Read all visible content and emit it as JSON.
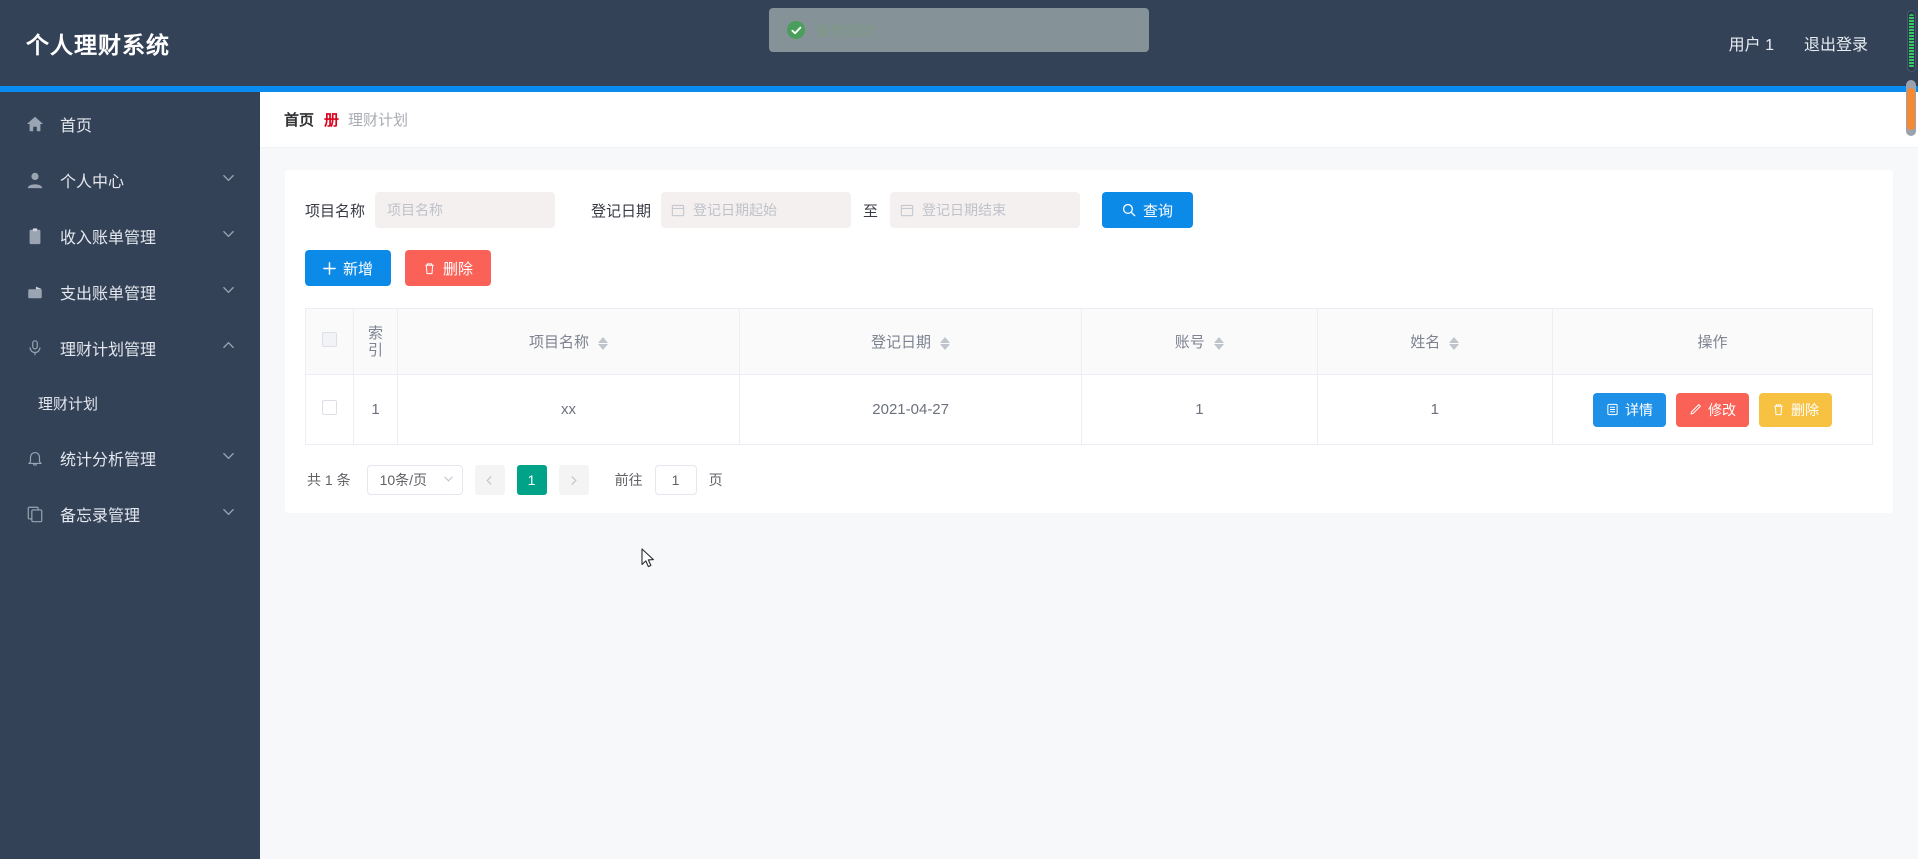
{
  "app": {
    "brand": "个人理财系统",
    "accent_blue": "#0c8ae8",
    "sidebar_bg": "#344258",
    "danger_red": "#fa6257",
    "warn_amber": "#f7c242",
    "page_active_teal": "#00a387"
  },
  "topbar": {
    "user_label": "用户 1",
    "logout_label": "退出登录"
  },
  "toast": {
    "message": "操作成功",
    "icon": "success-check-icon"
  },
  "sidebar": {
    "items": [
      {
        "label": "首页",
        "icon": "home-icon",
        "expandable": false
      },
      {
        "label": "个人中心",
        "icon": "user-icon",
        "expandable": true,
        "chevron": "down"
      },
      {
        "label": "收入账单管理",
        "icon": "clipboard-icon",
        "expandable": true,
        "chevron": "down"
      },
      {
        "label": "支出账单管理",
        "icon": "briefcase-icon",
        "expandable": true,
        "chevron": "down"
      },
      {
        "label": "理财计划管理",
        "icon": "microphone-icon",
        "expandable": true,
        "chevron": "up"
      },
      {
        "label": "统计分析管理",
        "icon": "bell-icon",
        "expandable": true,
        "chevron": "down"
      },
      {
        "label": "备忘录管理",
        "icon": "copy-icon",
        "expandable": true,
        "chevron": "down"
      }
    ],
    "submenu": {
      "label": "理财计划",
      "parent_index": 4
    }
  },
  "breadcrumb": {
    "home": "首页",
    "separator": "册",
    "current": "理财计划"
  },
  "filters": {
    "name_label": "项目名称",
    "name_value": "",
    "name_placeholder": "项目名称",
    "date_label": "登记日期",
    "date_start_placeholder": "登记日期起始",
    "date_start_value": "",
    "range_separator": "至",
    "date_end_placeholder": "登记日期结束",
    "date_end_value": "",
    "search_label": "查询",
    "search_icon": "search-icon"
  },
  "actions": {
    "add_label": "新增",
    "add_icon": "plus-icon",
    "delete_label": "删除",
    "delete_icon": "trash-icon"
  },
  "table": {
    "columns": [
      {
        "key": "select",
        "label": "",
        "sortable": false
      },
      {
        "key": "index",
        "label": "索引",
        "sortable": false
      },
      {
        "key": "project_name",
        "label": "项目名称",
        "sortable": true
      },
      {
        "key": "register_date",
        "label": "登记日期",
        "sortable": true
      },
      {
        "key": "account",
        "label": "账号",
        "sortable": true
      },
      {
        "key": "name",
        "label": "姓名",
        "sortable": true
      },
      {
        "key": "operations",
        "label": "操作",
        "sortable": false
      }
    ],
    "rows": [
      {
        "index": "1",
        "project_name": "xx",
        "register_date": "2021-04-27",
        "account": "1",
        "name": "1"
      }
    ],
    "row_ops": [
      {
        "label": "详情",
        "icon": "document-icon",
        "style": "detail"
      },
      {
        "label": "修改",
        "icon": "pencil-icon",
        "style": "edit"
      },
      {
        "label": "删除",
        "icon": "trash-icon",
        "style": "delete"
      }
    ]
  },
  "pagination": {
    "total_text": "共 1 条",
    "page_size_label": "10条/页",
    "prev_icon": "chevron-left-icon",
    "next_icon": "chevron-right-icon",
    "current_page": "1",
    "jump_prefix": "前往",
    "jump_value": "1",
    "jump_suffix": "页"
  }
}
